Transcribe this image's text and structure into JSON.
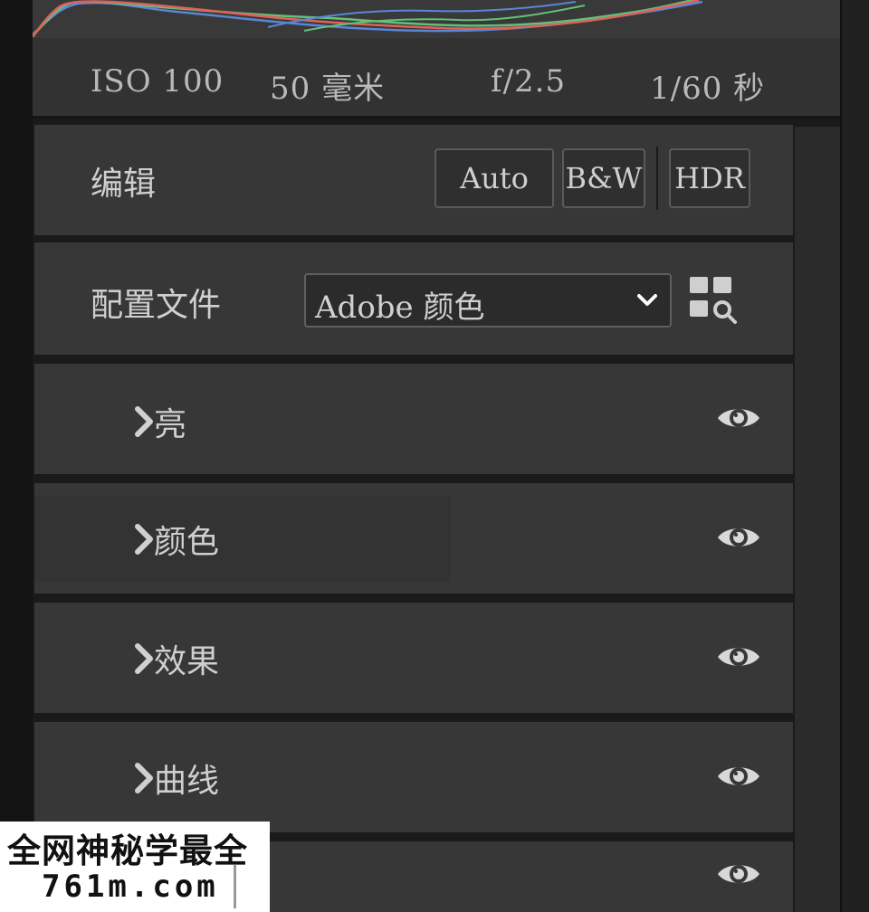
{
  "camera_info": {
    "iso": "ISO 100",
    "focal_length": "50 毫米",
    "aperture": "f/2.5",
    "shutter": "1/60 秒"
  },
  "edit": {
    "title": "编辑",
    "auto_label": "Auto",
    "bw_label": "B&W",
    "hdr_label": "HDR"
  },
  "profile": {
    "title": "配置文件",
    "selected": "Adobe 颜色"
  },
  "sections": [
    {
      "label": "亮",
      "icon": "chevron-right-icon"
    },
    {
      "label": "颜色",
      "icon": "chevron-right-icon"
    },
    {
      "label": "效果",
      "icon": "chevron-right-icon"
    },
    {
      "label": "曲线",
      "icon": "chevron-right-icon"
    },
    {
      "label": "",
      "icon": "eye-icon"
    }
  ],
  "watermark": {
    "line1": "全网神秘学最全",
    "line2": "761m.com"
  },
  "colors": {
    "panel_bg": "#373737",
    "app_bg": "#1a1a1a",
    "text": "#cfcfcf",
    "histogram_red": "#e0605a",
    "histogram_green": "#62c27a",
    "histogram_blue": "#5a86d8"
  }
}
